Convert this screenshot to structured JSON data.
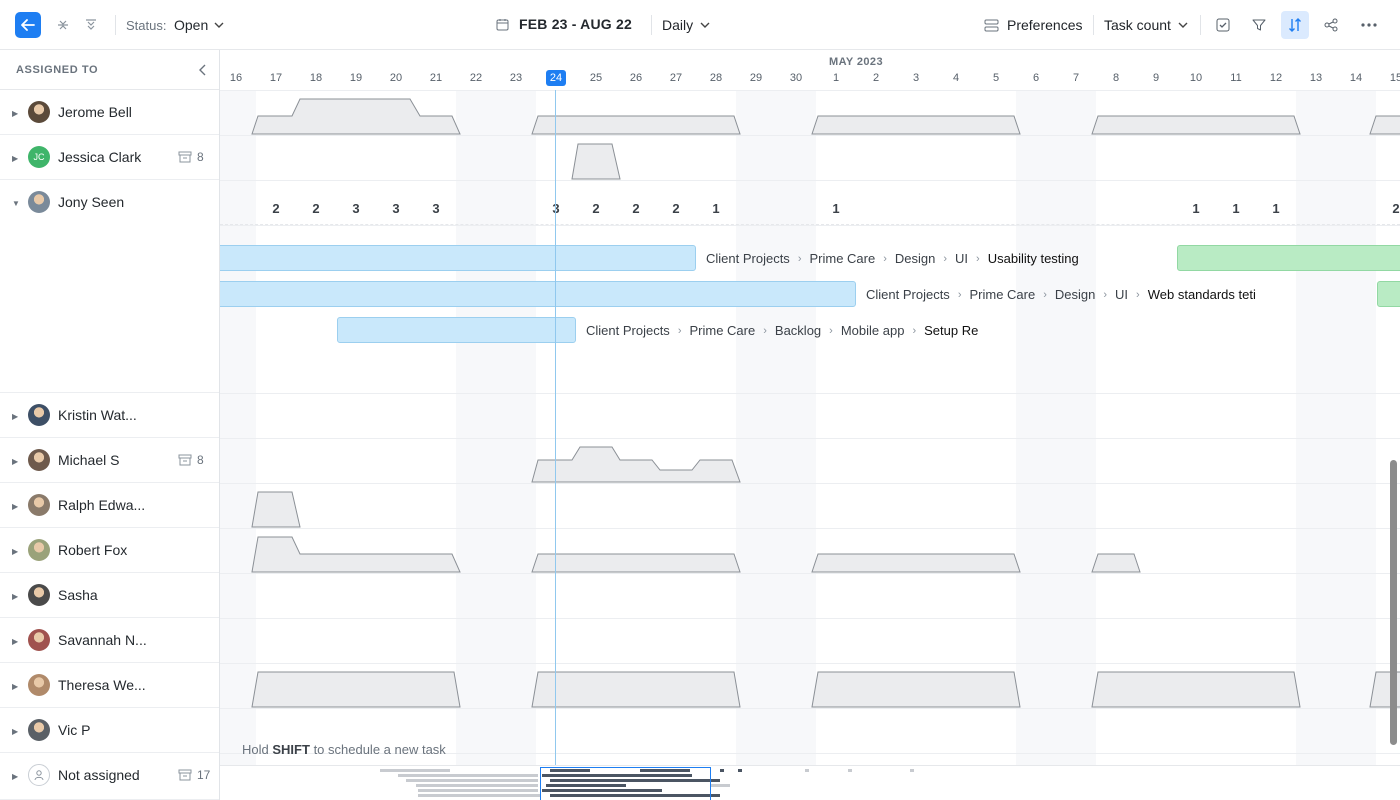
{
  "toolbar": {
    "status_label": "Status:",
    "status_value": "Open",
    "date_range": "FEB 23 - AUG 22",
    "scale": "Daily",
    "preferences": "Preferences",
    "metric": "Task count"
  },
  "sidebar": {
    "title": "ASSIGNED TO",
    "people": [
      {
        "name": "Jerome Bell",
        "initials": "",
        "avatar_color": "#5b4a3a",
        "badge": ""
      },
      {
        "name": "Jessica Clark",
        "initials": "JC",
        "avatar_color": "#3fb56a",
        "badge": "8"
      },
      {
        "name": "Jony Seen",
        "initials": "",
        "avatar_color": "#7a8a9a",
        "badge": ""
      },
      {
        "name": "Kristin Wat...",
        "initials": "",
        "avatar_color": "#3d4f66",
        "badge": ""
      },
      {
        "name": "Michael S",
        "initials": "",
        "avatar_color": "#6e5a4c",
        "badge": "8"
      },
      {
        "name": "Ralph Edwa...",
        "initials": "",
        "avatar_color": "#8a7a6a",
        "badge": ""
      },
      {
        "name": "Robert Fox",
        "initials": "",
        "avatar_color": "#9aa27a",
        "badge": ""
      },
      {
        "name": "Sasha",
        "initials": "",
        "avatar_color": "#4a4a4a",
        "badge": ""
      },
      {
        "name": "Savannah N...",
        "initials": "",
        "avatar_color": "#a0524e",
        "badge": ""
      },
      {
        "name": "Theresa We...",
        "initials": "",
        "avatar_color": "#b08a6a",
        "badge": ""
      },
      {
        "name": "Vic P",
        "initials": "",
        "avatar_color": "#5a6066",
        "badge": ""
      },
      {
        "name": "Not assigned",
        "initials": "",
        "avatar_color": "#ffffff",
        "badge": "17"
      }
    ]
  },
  "timeline": {
    "month_label": "MAY 2023",
    "days": [
      "16",
      "17",
      "18",
      "19",
      "20",
      "21",
      "22",
      "23",
      "24",
      "25",
      "26",
      "27",
      "28",
      "29",
      "30",
      "1",
      "2",
      "3",
      "4",
      "5",
      "6",
      "7",
      "8",
      "9",
      "10",
      "11",
      "12",
      "13",
      "14",
      "15"
    ],
    "today": "24",
    "jony_counts": [
      "",
      "2",
      "2",
      "3",
      "3",
      "3",
      "",
      "",
      "3",
      "2",
      "2",
      "2",
      "1",
      "",
      "",
      "1",
      "",
      "",
      "",
      "",
      "",
      "",
      "",
      "",
      "1",
      "1",
      "1",
      "",
      "",
      "2"
    ],
    "tasks": [
      {
        "path": [
          "Client Projects",
          "Prime Care",
          "Design",
          "UI"
        ],
        "title": "Usability testing",
        "color": "blue"
      },
      {
        "path": [
          "Client Projects",
          "Prime Care",
          "Design",
          "UI"
        ],
        "title": "Web standards teti",
        "color": "blue"
      },
      {
        "path": [
          "Client Projects",
          "Prime Care",
          "Backlog",
          "Mobile app"
        ],
        "title": "Setup Re",
        "color": "blue"
      }
    ],
    "hint_prefix": "Hold",
    "hint_key": "SHIFT",
    "hint_suffix": "to schedule a new task"
  },
  "colors": {
    "accent": "#1e7ef2",
    "bar_blue": "#c9e8fb",
    "bar_green": "#b9ebc4",
    "today_line": "#90c8ee"
  }
}
